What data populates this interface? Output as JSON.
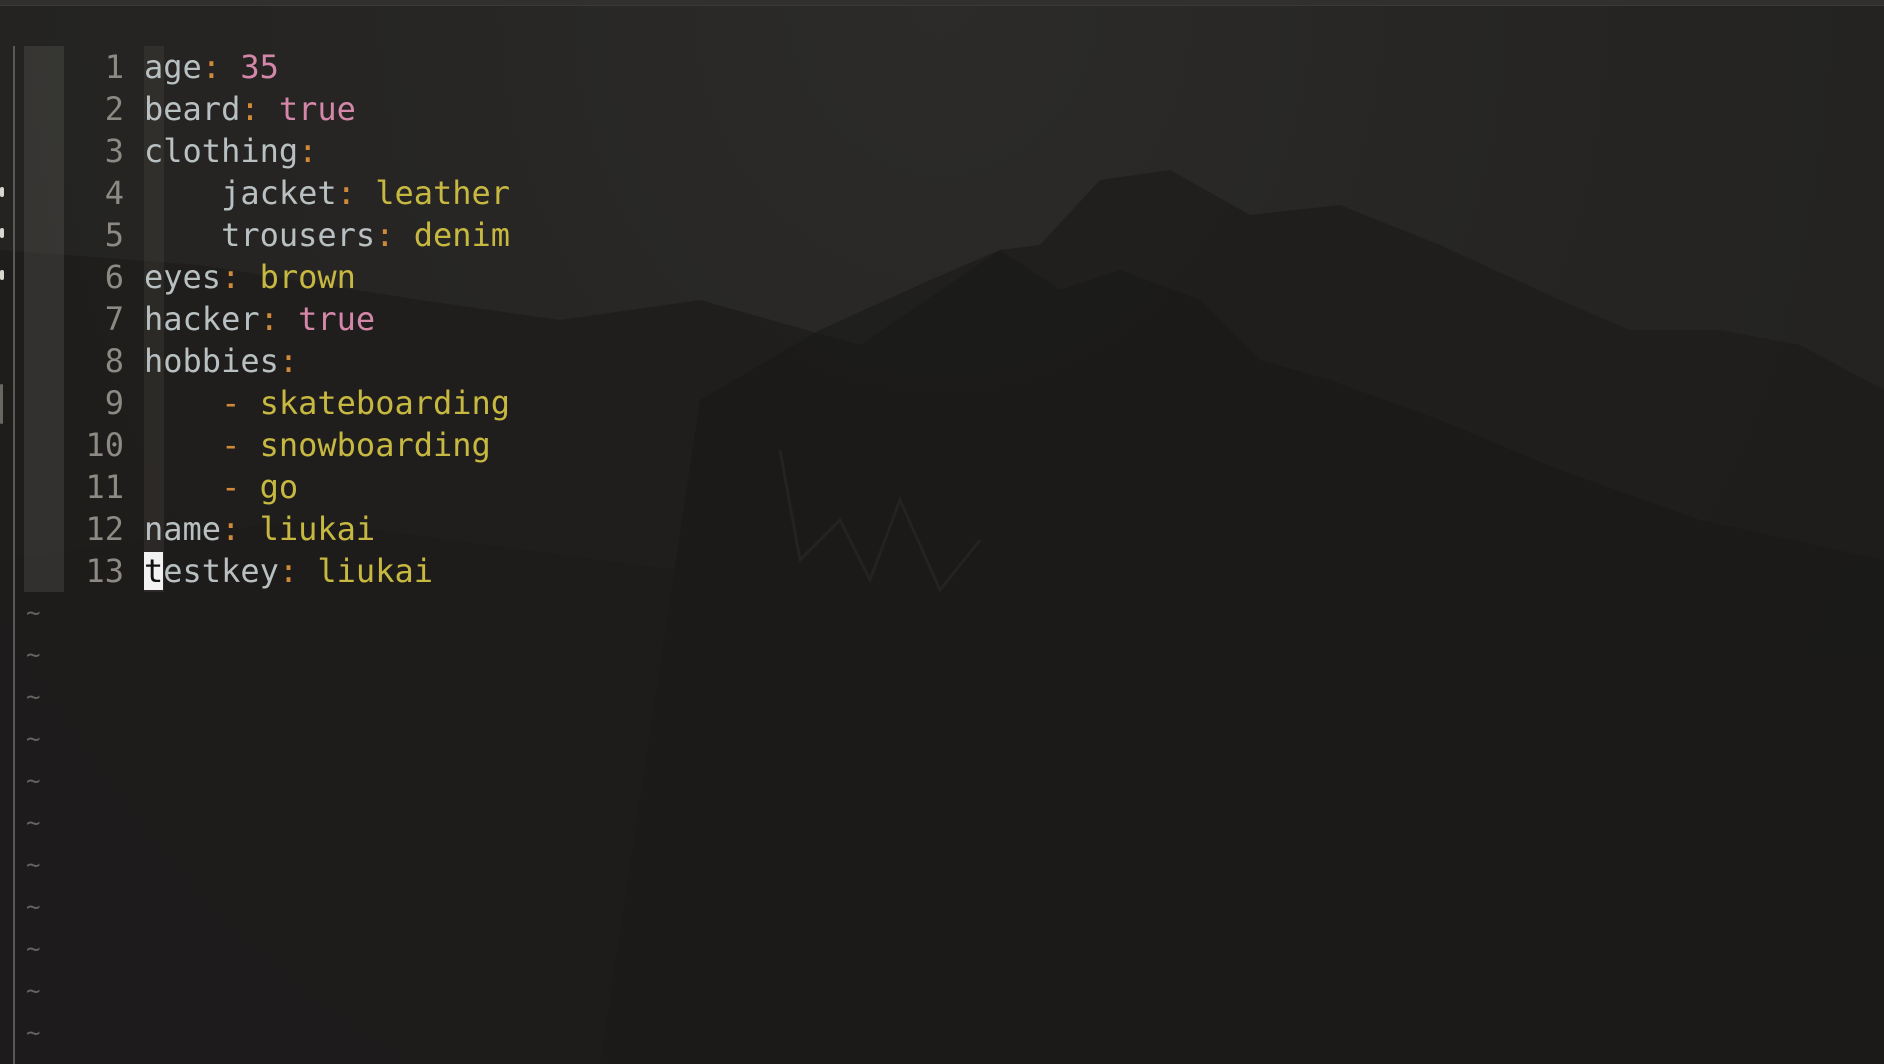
{
  "editor": {
    "lines": [
      {
        "num": "1",
        "indent": "",
        "key": "age",
        "colon": ":",
        "dash": "",
        "value": " 35",
        "value_type": "num"
      },
      {
        "num": "2",
        "indent": "",
        "key": "beard",
        "colon": ":",
        "dash": "",
        "value": " true",
        "value_type": "bool"
      },
      {
        "num": "3",
        "indent": "",
        "key": "clothing",
        "colon": ":",
        "dash": "",
        "value": "",
        "value_type": "str"
      },
      {
        "num": "4",
        "indent": "    ",
        "key": "jacket",
        "colon": ":",
        "dash": "",
        "value": " leather",
        "value_type": "str"
      },
      {
        "num": "5",
        "indent": "    ",
        "key": "trousers",
        "colon": ":",
        "dash": "",
        "value": " denim",
        "value_type": "str"
      },
      {
        "num": "6",
        "indent": "",
        "key": "eyes",
        "colon": ":",
        "dash": "",
        "value": " brown",
        "value_type": "str"
      },
      {
        "num": "7",
        "indent": "",
        "key": "hacker",
        "colon": ":",
        "dash": "",
        "value": " true",
        "value_type": "bool"
      },
      {
        "num": "8",
        "indent": "",
        "key": "hobbies",
        "colon": ":",
        "dash": "",
        "value": "",
        "value_type": "str"
      },
      {
        "num": "9",
        "indent": "    ",
        "key": "",
        "colon": "",
        "dash": "-",
        "value": " skateboarding",
        "value_type": "str"
      },
      {
        "num": "10",
        "indent": "    ",
        "key": "",
        "colon": "",
        "dash": "-",
        "value": " snowboarding",
        "value_type": "str"
      },
      {
        "num": "11",
        "indent": "    ",
        "key": "",
        "colon": "",
        "dash": "-",
        "value": " go",
        "value_type": "str"
      },
      {
        "num": "12",
        "indent": "",
        "key": "name",
        "colon": ":",
        "dash": "",
        "value": " liukai",
        "value_type": "str"
      }
    ],
    "cursor_line": {
      "num": "13",
      "cursor_char": "t",
      "key_rest": "estkey",
      "colon": ":",
      "value": " liukai"
    },
    "tilde": "~",
    "tilde_count": 11
  },
  "colors": {
    "key": "#b9c0c2",
    "colon": "#d08a3a",
    "number": "#d487a8",
    "boolean": "#d487a8",
    "string": "#c6b840",
    "line_number": "#8d8a84",
    "tilde": "#66635f",
    "cursor_bg": "#f2f2f2"
  }
}
